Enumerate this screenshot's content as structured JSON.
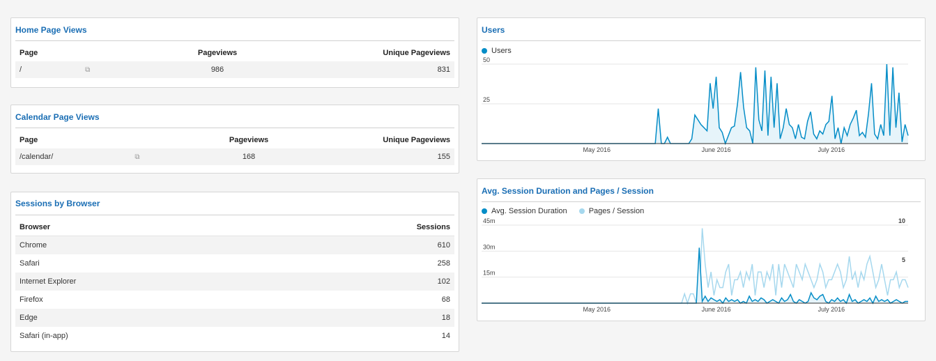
{
  "home_page_views": {
    "title": "Home Page Views",
    "columns": [
      "Page",
      "Pageviews",
      "Unique Pageviews"
    ],
    "rows": [
      {
        "page": "/",
        "pageviews": "986",
        "unique": "831"
      }
    ]
  },
  "calendar_page_views": {
    "title": "Calendar Page Views",
    "columns": [
      "Page",
      "Pageviews",
      "Unique Pageviews"
    ],
    "rows": [
      {
        "page": "/calendar/",
        "pageviews": "168",
        "unique": "155"
      }
    ]
  },
  "sessions_by_browser": {
    "title": "Sessions by Browser",
    "columns": [
      "Browser",
      "Sessions"
    ],
    "rows": [
      {
        "browser": "Chrome",
        "sessions": "610"
      },
      {
        "browser": "Safari",
        "sessions": "258"
      },
      {
        "browser": "Internet Explorer",
        "sessions": "102"
      },
      {
        "browser": "Firefox",
        "sessions": "68"
      },
      {
        "browser": "Edge",
        "sessions": "18"
      },
      {
        "browser": "Safari (in-app)",
        "sessions": "14"
      }
    ]
  },
  "users_widget": {
    "title": "Users",
    "legend": "Users",
    "color": "#058dc7"
  },
  "session_widget": {
    "title": "Avg. Session Duration and Pages / Session",
    "legend_a": "Avg. Session Duration",
    "legend_b": "Pages / Session",
    "color_a": "#058dc7",
    "color_b": "#a6d8ee"
  },
  "chart_data": [
    {
      "type": "area",
      "title": "Users",
      "series": [
        {
          "name": "Users",
          "values": [
            0,
            0,
            0,
            0,
            0,
            0,
            0,
            0,
            0,
            0,
            0,
            0,
            0,
            0,
            0,
            0,
            0,
            0,
            0,
            0,
            0,
            0,
            0,
            0,
            0,
            0,
            0,
            0,
            0,
            0,
            0,
            0,
            0,
            0,
            0,
            0,
            0,
            0,
            0,
            0,
            0,
            0,
            0,
            0,
            0,
            0,
            0,
            0,
            0,
            0,
            0,
            0,
            0,
            0,
            0,
            0,
            0,
            0,
            22,
            0,
            0,
            4,
            0,
            0,
            0,
            0,
            0,
            0,
            0,
            3,
            18,
            15,
            12,
            10,
            8,
            38,
            22,
            42,
            10,
            7,
            0,
            5,
            10,
            11,
            25,
            45,
            23,
            10,
            8,
            0,
            48,
            15,
            8,
            46,
            5,
            42,
            10,
            38,
            3,
            10,
            22,
            12,
            10,
            3,
            12,
            4,
            3,
            14,
            20,
            6,
            3,
            8,
            6,
            12,
            14,
            30,
            3,
            10,
            0,
            10,
            5,
            12,
            16,
            21,
            5,
            7,
            4,
            19,
            38,
            6,
            3,
            12,
            5,
            50,
            5,
            48,
            10,
            32,
            1,
            12,
            5
          ]
        }
      ],
      "x_tick_labels": [
        "May 2016",
        "June 2016",
        "July 2016"
      ],
      "y_tick_labels": [
        "50",
        "25"
      ],
      "ylim": [
        0,
        50
      ]
    },
    {
      "type": "area",
      "title": "Avg. Session Duration and Pages / Session",
      "series": [
        {
          "name": "Avg. Session Duration",
          "values": [
            0,
            0,
            0,
            0,
            0,
            0,
            0,
            0,
            0,
            0,
            0,
            0,
            0,
            0,
            0,
            0,
            0,
            0,
            0,
            0,
            0,
            0,
            0,
            0,
            0,
            0,
            0,
            0,
            0,
            0,
            0,
            0,
            0,
            0,
            0,
            0,
            0,
            0,
            0,
            0,
            0,
            0,
            0,
            0,
            0,
            0,
            0,
            0,
            0,
            0,
            0,
            0,
            0,
            0,
            0,
            0,
            0,
            0,
            0,
            0,
            0,
            0,
            0,
            0,
            0,
            0,
            0,
            0,
            0,
            0,
            0,
            0,
            0,
            0,
            32,
            1,
            4,
            1,
            3,
            2,
            1,
            2,
            0,
            3,
            1,
            2,
            1,
            2,
            0,
            1,
            0,
            4,
            1,
            2,
            1,
            3,
            2,
            0,
            1,
            2,
            1,
            0,
            3,
            1,
            2,
            5,
            1,
            0,
            2,
            1,
            0,
            1,
            6,
            3,
            2,
            4,
            5,
            1,
            0,
            2,
            1,
            3,
            1,
            2,
            0,
            5,
            1,
            2,
            0,
            1,
            2,
            1,
            3,
            0,
            4,
            1,
            2,
            1,
            2,
            0,
            1,
            2,
            1,
            0,
            1,
            1
          ]
        },
        {
          "name": "Pages / Session",
          "values": [
            0,
            0,
            0,
            0,
            0,
            0,
            0,
            0,
            0,
            0,
            0,
            0,
            0,
            0,
            0,
            0,
            0,
            0,
            0,
            0,
            0,
            0,
            0,
            0,
            0,
            0,
            0,
            0,
            0,
            0,
            0,
            0,
            0,
            0,
            0,
            0,
            0,
            0,
            0,
            0,
            0,
            0,
            0,
            0,
            0,
            0,
            0,
            0,
            0,
            0,
            0,
            0,
            0,
            0,
            0,
            0,
            0,
            0,
            0,
            0,
            0,
            0,
            0,
            0,
            0,
            0,
            0,
            0,
            0,
            1.2,
            0,
            1.2,
            1.2,
            0,
            0,
            9.6,
            5,
            2,
            4,
            1,
            3,
            2,
            2,
            4,
            5,
            1,
            3,
            3,
            4,
            2,
            4,
            3,
            5,
            1,
            4,
            4,
            2,
            4,
            3,
            5,
            1,
            5,
            2,
            5,
            4,
            3,
            2,
            5,
            4,
            3,
            5,
            4,
            3,
            2,
            3,
            5,
            4,
            2,
            3,
            3,
            4,
            5,
            4,
            2,
            3,
            6,
            3,
            4,
            2,
            4,
            3,
            5,
            6,
            4,
            2,
            3,
            5,
            3,
            1,
            3,
            3,
            4,
            2,
            3,
            3,
            2
          ]
        }
      ],
      "x_tick_labels": [
        "May 2016",
        "June 2016",
        "July 2016"
      ],
      "y_left_tick_labels": [
        "45m",
        "30m",
        "15m"
      ],
      "y_right_tick_labels": [
        "10",
        "5"
      ]
    }
  ]
}
